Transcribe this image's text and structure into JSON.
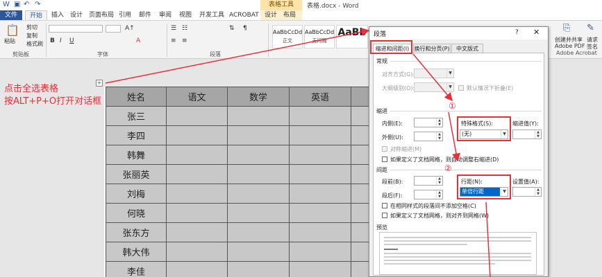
{
  "titlebar": {
    "context_tools": "表格工具",
    "doc_title": "表格.docx - Word"
  },
  "tabs": [
    {
      "label": "文件"
    },
    {
      "label": "开始"
    },
    {
      "label": "插入"
    },
    {
      "label": "设计"
    },
    {
      "label": "页面布局"
    },
    {
      "label": "引用"
    },
    {
      "label": "邮件"
    },
    {
      "label": "审阅"
    },
    {
      "label": "视图"
    },
    {
      "label": "开发工具"
    },
    {
      "label": "ACROBAT"
    },
    {
      "label": "设计"
    },
    {
      "label": "布局"
    }
  ],
  "ribbon": {
    "clipboard": {
      "paste": "粘贴",
      "cut": "剪切",
      "copy": "复制",
      "format_painter": "格式刷",
      "group": "剪贴板"
    },
    "font": {
      "group": "字体"
    },
    "paragraph": {
      "group": "段落"
    },
    "styles": [
      {
        "sample": "AaBbCcDd",
        "name": "正文"
      },
      {
        "sample": "AaBbCcDd",
        "name": "无间隔"
      },
      {
        "sample": "AaBb",
        "name": ""
      }
    ],
    "adobe": {
      "create_share": "创建并共享",
      "pdf": "Adobe PDF",
      "request": "请求",
      "sign": "签名",
      "group": "Adobe Acrobat"
    }
  },
  "annotation": {
    "line1": "点击全选表格",
    "line2": "按ALT+P+O打开对话框"
  },
  "table": {
    "headers": [
      "姓名",
      "语文",
      "数学",
      "英语",
      ""
    ],
    "names": [
      "张三",
      "李四",
      "韩舞",
      "张丽英",
      "刘梅",
      "何晓",
      "张东方",
      "韩大伟",
      "李佳"
    ]
  },
  "dialog": {
    "title": "段落",
    "help": "?",
    "close": "✕",
    "tabs": [
      "缩进和间距(I)",
      "换行和分页(P)",
      "中文版式(H)"
    ],
    "general": {
      "section": "常规",
      "alignment_label": "对齐方式(G):",
      "outline_label": "大纲级别(O):",
      "collapse_default": "默认情况下折叠(E)"
    },
    "indent": {
      "section": "缩进",
      "inside_label": "内侧(E):",
      "outside_label": "外侧(U):",
      "special_label": "特殊格式(S):",
      "special_value": "(无)",
      "indent_value_label": "缩进值(Y):",
      "mirror": "对称缩进(M)",
      "auto_adjust": "如果定义了文档网格，则自动调整右缩进(D)"
    },
    "spacing": {
      "section": "间距",
      "before_label": "段前(B):",
      "after_label": "段后(F):",
      "line_label": "行距(N):",
      "line_value": "单倍行距",
      "setting_label": "设置值(A):",
      "no_space_same": "在相同样式的段落间不添加空格(C)",
      "snap_grid": "如果定义了文档网格，则对齐到网格(W)"
    },
    "preview": {
      "section": "预览"
    }
  },
  "markers": {
    "one": "①",
    "two": "②"
  },
  "colors": {
    "accent_red": "#e8303a",
    "word_blue": "#2b579a",
    "selection_blue": "#0066cc"
  }
}
